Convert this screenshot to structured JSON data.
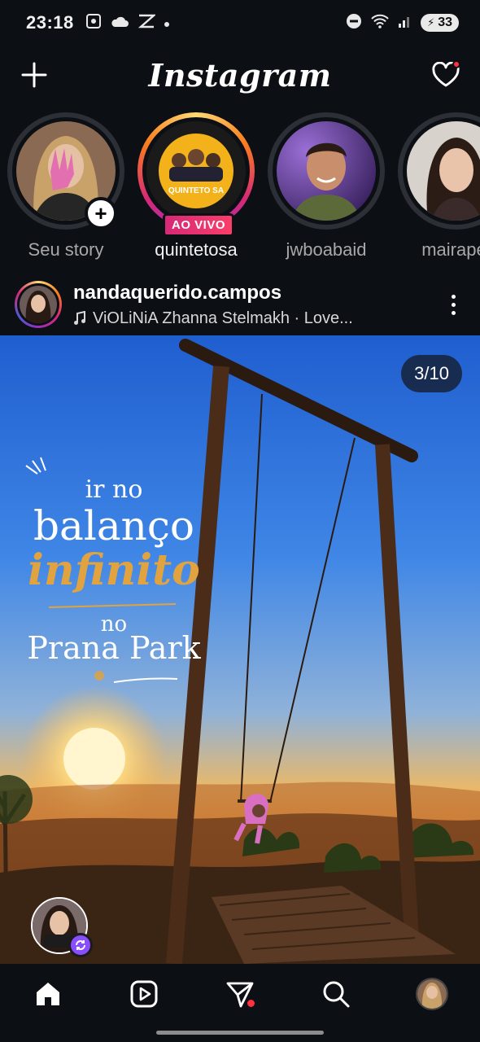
{
  "status_bar": {
    "time": "23:18",
    "battery": "33",
    "left_icons": [
      "screenshot-icon",
      "cloud-icon",
      "capcut-icon",
      "dot-icon"
    ],
    "right_icons": [
      "dnd-icon",
      "wifi-icon",
      "signal-icon",
      "battery-icon"
    ]
  },
  "header": {
    "title": "Instagram",
    "has_notification": true
  },
  "stories": [
    {
      "username": "Seu story",
      "type": "own",
      "has_add": true
    },
    {
      "username": "quintetosa",
      "type": "live",
      "live_label": "AO VIVO",
      "avatar_text": "QUINTETO SA"
    },
    {
      "username": "jwboabaid",
      "type": "seen"
    },
    {
      "username": "mairapet",
      "type": "seen"
    }
  ],
  "post": {
    "username": "nandaquerido.campos",
    "music": "ViOLiNiA Zhanna Stelmakh · Love...",
    "counter": "3/10",
    "overlay": {
      "line1": "ir no",
      "line2": "balanço",
      "line3": "infinito",
      "line4": "no",
      "line5": "Prana Park"
    }
  },
  "nav": {
    "items": [
      "home-icon",
      "reels-icon",
      "direct-icon",
      "search-icon",
      "profile-avatar"
    ],
    "direct_has_dot": true
  },
  "colors": {
    "background": "#0c0f14",
    "live": "#d62976",
    "notification": "#ff3040",
    "accent_gold": "#e0a33f"
  }
}
